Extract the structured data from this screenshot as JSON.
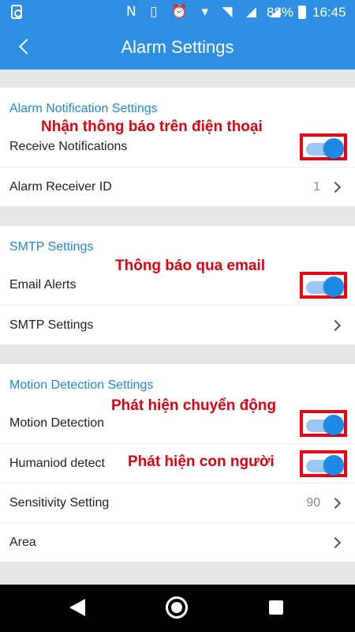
{
  "status_bar": {
    "icons": "N ▯ ⏰ ▾ ◥ ◢ ◢",
    "battery": "88%",
    "time": "16:45"
  },
  "header": {
    "title": "Alarm Settings"
  },
  "sections": {
    "alarm": {
      "title": "Alarm Notification Settings",
      "receive_notifications": {
        "label": "Receive Notifications",
        "on": true
      },
      "receiver_id": {
        "label": "Alarm Receiver ID",
        "value": "1"
      }
    },
    "smtp": {
      "title": "SMTP Settings",
      "email_alerts": {
        "label": "Email Alerts",
        "on": true
      },
      "smtp_settings": {
        "label": "SMTP Settings"
      }
    },
    "motion": {
      "title": "Motion Detection Settings",
      "motion_detection": {
        "label": "Motion Detection",
        "on": true
      },
      "humanoid": {
        "label": "Humaniod detect",
        "on": true
      },
      "sensitivity": {
        "label": "Sensitivity Setting",
        "value": "90"
      },
      "area": {
        "label": "Area"
      }
    }
  },
  "annotations": {
    "receive": "Nhận thông báo trên điện thoại",
    "email": "Thông báo qua email",
    "motion": "Phát hiện chuyển động",
    "human": "Phát hiện con người"
  },
  "colors": {
    "accent": "#2d8ee3",
    "section_title": "#1e88e5",
    "annotation": "#e3000f"
  }
}
